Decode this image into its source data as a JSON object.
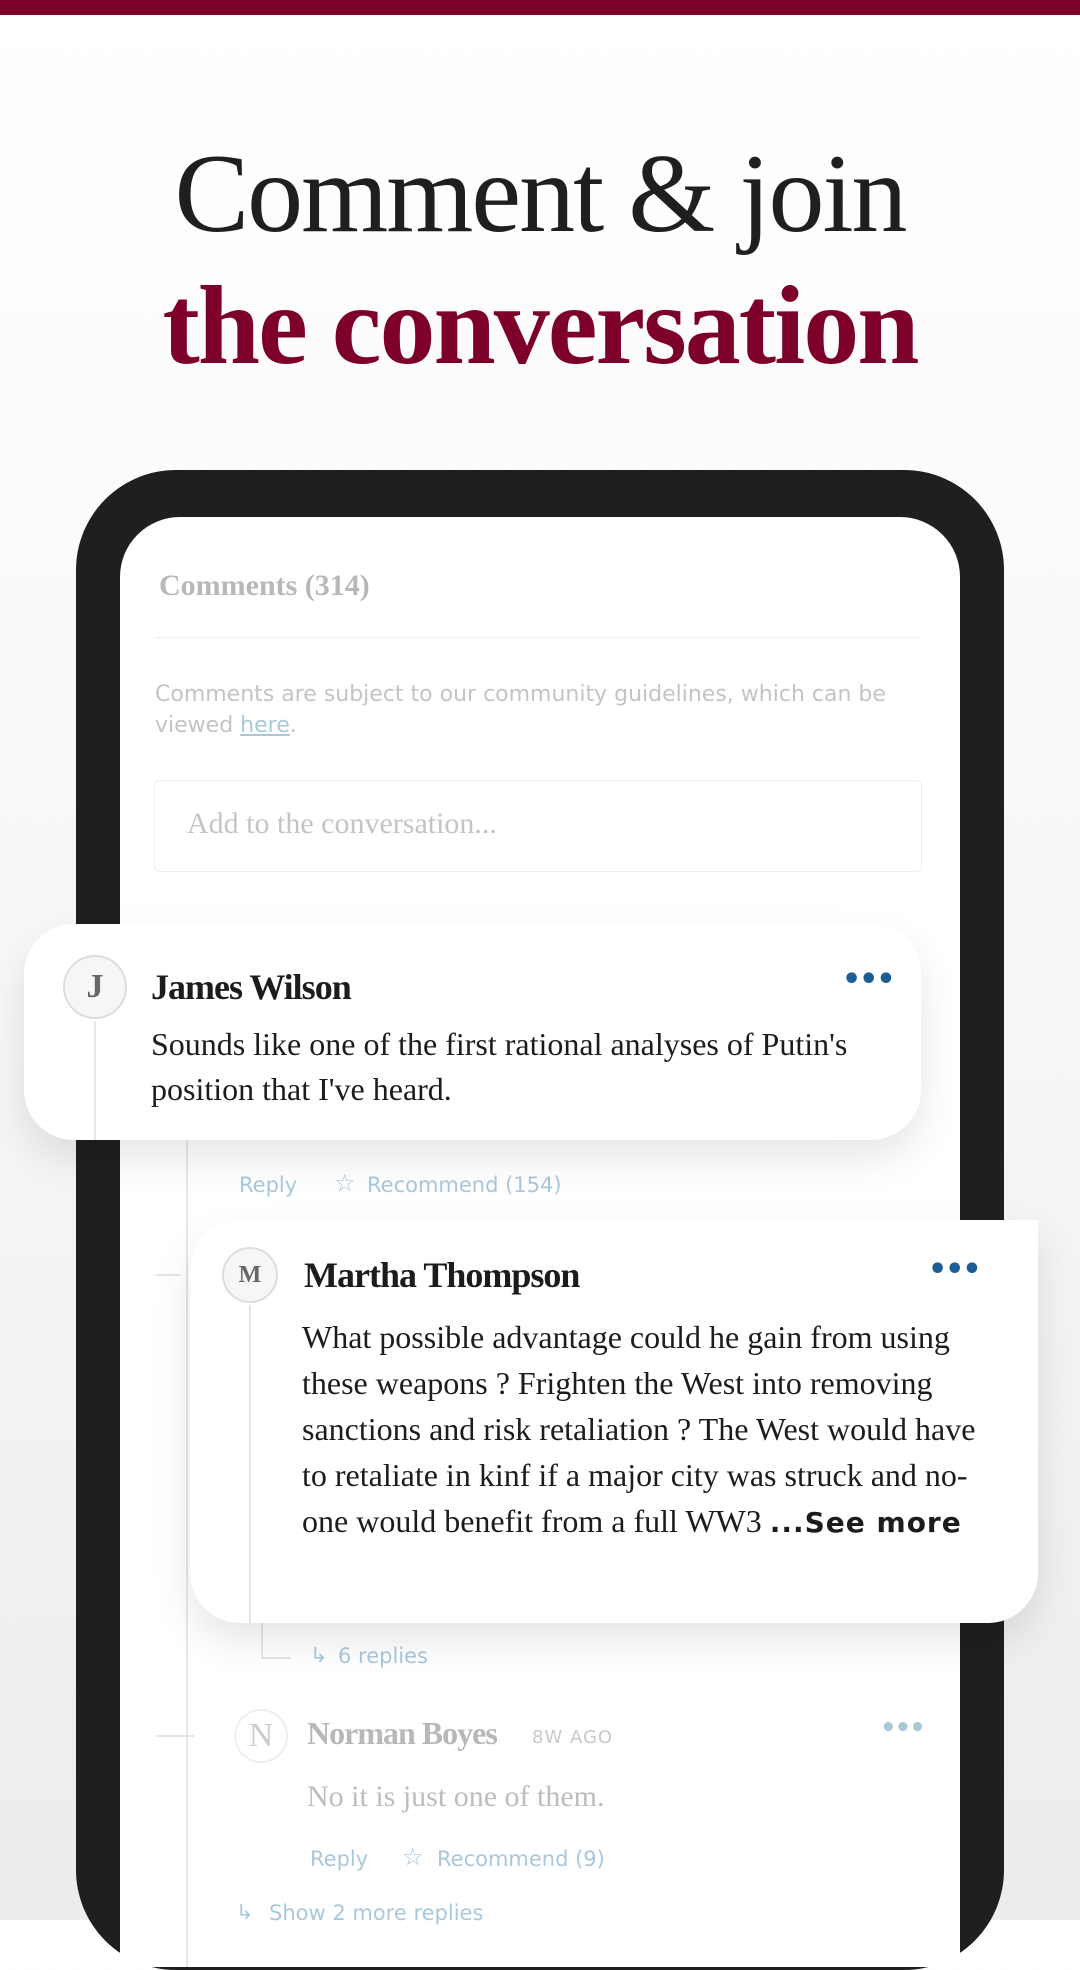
{
  "headline": {
    "line1": "Comment & join",
    "line2": "the conversation"
  },
  "colors": {
    "brand": "#7d0029",
    "link": "#a9c8dc",
    "menu_dots": "#1c5e94"
  },
  "comments_panel": {
    "title": "Comments  (314)",
    "guidelines_prefix": "Comments are subject to our community guidelines, which can be viewed ",
    "guidelines_link": "here",
    "guidelines_suffix": ".",
    "input_placeholder": "Add to the conversation..."
  },
  "comments": [
    {
      "initial": "J",
      "author": "James Wilson",
      "text": "Sounds like one of the first rational analyses of Putin's position that I've heard.",
      "reply": "Reply",
      "recommend": "Recommend (154)",
      "menu_icon": "more-dots-icon"
    },
    {
      "initial": "M",
      "author": "Martha Thompson",
      "text": "What possible advantage could he gain from using these weapons ? Frighten the West into removing sanctions and risk retaliation ? The West would have to retaliate in kinf if a major city was struck and no-one would benefit from a full WW3 ",
      "see_more": "...See more",
      "replies": "6 replies",
      "menu_icon": "more-dots-icon"
    },
    {
      "initial": "N",
      "author": "Norman Boyes",
      "time": "8W AGO",
      "text": "No it is just one of them.",
      "reply": "Reply",
      "recommend": "Recommend (9)",
      "menu_icon": "more-dots-icon"
    }
  ],
  "show_more_replies": "Show 2 more replies"
}
